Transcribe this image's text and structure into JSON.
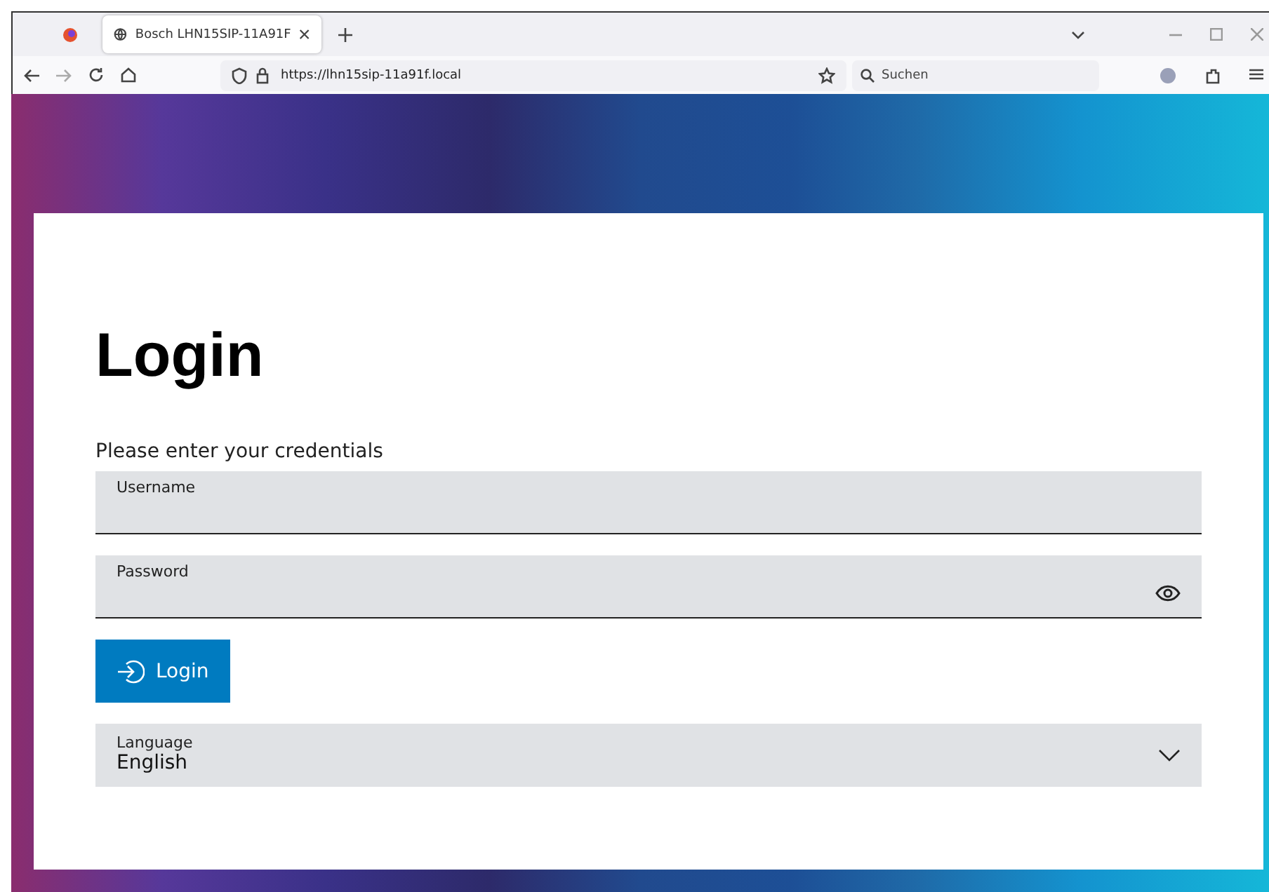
{
  "browser": {
    "tab": {
      "title": "Bosch LHN15SIP-11A91F",
      "selected": true
    },
    "url": "https://lhn15sip-11a91f.local",
    "search": {
      "placeholder": "Suchen"
    }
  },
  "login": {
    "title": "Login",
    "subtitle": "Please enter your credentials",
    "fields": [
      {
        "kind": "text",
        "label": "Username"
      },
      {
        "kind": "password",
        "label": "Password"
      }
    ],
    "button": "Login",
    "language": {
      "label": "Language",
      "value": "English"
    }
  }
}
